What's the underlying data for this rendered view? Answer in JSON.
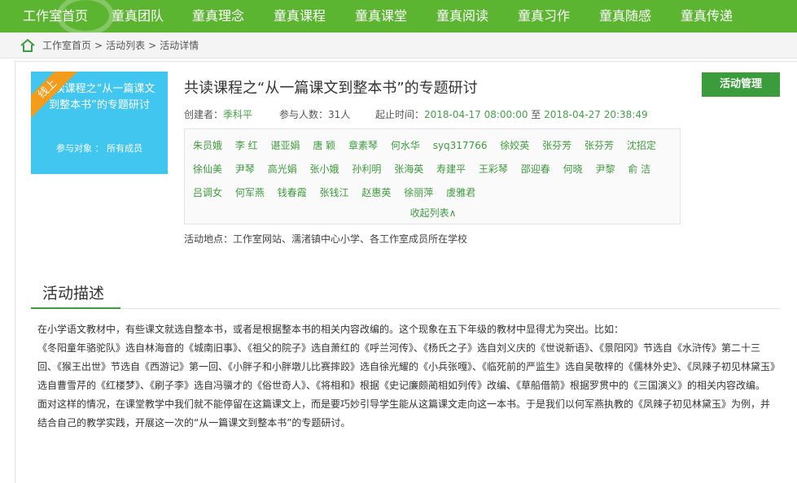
{
  "nav": {
    "items": [
      "工作室首页",
      "童真团队",
      "童真理念",
      "童真课程",
      "童真课堂",
      "童真阅读",
      "童真习作",
      "童真随感",
      "童真传递"
    ]
  },
  "breadcrumb": {
    "items": [
      "工作室首页",
      "活动列表",
      "活动详情"
    ],
    "separator": ">"
  },
  "cover": {
    "ribbon": "线上",
    "title": "共读课程之“从一篇课文到整本书”的专题研讨",
    "target": "参与对象 ： 所有成员"
  },
  "activity": {
    "title": "共读课程之“从一篇课文到整本书”的专题研讨",
    "creator_label": "创建者：",
    "creator": "季科平",
    "participants_label": "参与人数：",
    "participants": "31人",
    "time_label": "起止时间：",
    "start": "2018-04-17 08:00:00",
    "to": "至",
    "end": "2018-04-27 20:38:49",
    "manage_button": "活动管理",
    "location": "活动地点：工作室网站、濡渚镇中心小学、各工作室成员所在学校"
  },
  "members": {
    "names": [
      "朱员娥",
      "李 红",
      "谌亚娟",
      "唐 颖",
      "章素琴",
      "何水华",
      "syq317766",
      "徐姣英",
      "张芬芳",
      "张芬芳",
      "沈招定",
      "徐仙美",
      "尹琴",
      "高光娟",
      "张小娥",
      "孙利明",
      "张海英",
      "寿建平",
      "王彩琴",
      "邵迎春",
      "何晓",
      "尹黎",
      "俞 洁",
      "吕调女",
      "何军燕",
      "钱春霞",
      "张钱江",
      "赵惠英",
      "徐丽萍",
      "虞雅君"
    ],
    "collapse_label": "收起列表∧"
  },
  "description": {
    "heading": "活动描述",
    "paragraphs": [
      "在小学语文教材中，有些课文就选自整本书，或者是根据整本书的相关内容改编的。这个现象在五下年级的教材中显得尤为突出。比如：",
      "《冬阳童年骆驼队》选自林海音的《城南旧事》、《祖父的院子》选自萧红的《呼兰河传》、《杨氏之子》选自刘义庆的《世说新语》、《景阳冈》节选自《水浒传》第二十三回、《猴王出世》节选自《西游记》第一回、《小胖子和小胖墩儿比赛摔跤》选自徐光耀的《小兵张嘎》、《临死前的严监生》选自吴敬梓的《儒林外史》、《凤辣子初见林黛玉》选自曹雪芹的《红楼梦》、《刷子李》选自冯骥才的《俗世奇人》、《将相和》根据《史记廉颇蔺相如列传》改编、《草船借箭》根据罗贯中的《三国演义》的相关内容改编。",
      "面对这样的情况，在课堂教学中我们就不能停留在这篇课文上，而是要巧妙引导学生能从这篇课文走向这一本书。于是我们以何军燕执教的《凤辣子初见林黛玉》为例，并结合自己的教学实践，开展这一次的“从一篇课文到整本书”的专题研讨。"
    ]
  },
  "colors": {
    "nav_green": "#5cb531",
    "button_green": "#3a9c3b",
    "cover_blue": "#41c6f0",
    "ribbon_orange": "#f39c1c"
  }
}
